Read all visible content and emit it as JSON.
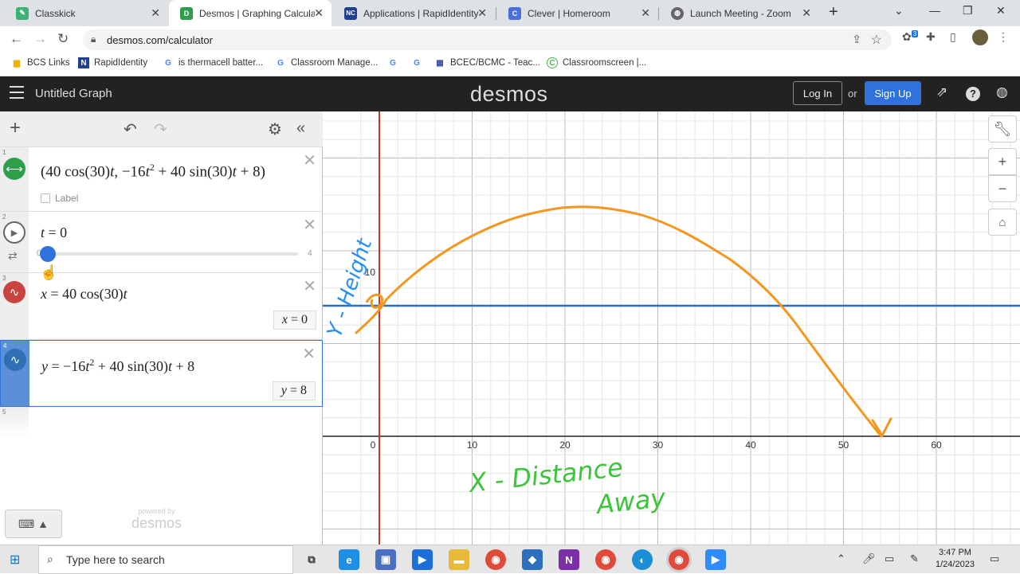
{
  "browser": {
    "tabs": [
      {
        "title": "Classkick",
        "icon": "classkick-icon",
        "color": "#3bb273",
        "glyph": "✎",
        "active": false
      },
      {
        "title": "Desmos | Graphing Calculato",
        "icon": "desmos-icon",
        "color": "#2e9e4a",
        "glyph": "D",
        "active": true
      },
      {
        "title": "Applications | RapidIdentity",
        "icon": "nc-icon",
        "color": "#1f3f8f",
        "glyph": "NC",
        "active": false
      },
      {
        "title": "Clever | Homeroom",
        "icon": "clever-icon",
        "color": "#4a6ee0",
        "glyph": "C",
        "active": false
      },
      {
        "title": "Launch Meeting - Zoom",
        "icon": "globe-icon",
        "color": "#666666",
        "glyph": "◍",
        "active": false
      }
    ],
    "url": "desmos.com/calculator",
    "extension_badge": "3",
    "bookmarks": [
      {
        "label": "BCS Links",
        "icon": "folder-icon",
        "color": "#e8b400",
        "glyph": "▆"
      },
      {
        "label": "RapidIdentity",
        "icon": "nc-icon",
        "color": "#1f3f8f",
        "glyph": "N"
      },
      {
        "label": "is thermacell batter...",
        "icon": "google-icon",
        "color": "#4285f4",
        "glyph": "G"
      },
      {
        "label": "Classroom Manage...",
        "icon": "google-icon",
        "color": "#4285f4",
        "glyph": "G"
      },
      {
        "label": "",
        "icon": "google-icon",
        "color": "#4285f4",
        "glyph": "G"
      },
      {
        "label": "",
        "icon": "google-icon",
        "color": "#4285f4",
        "glyph": "G"
      },
      {
        "label": "BCEC/BCMC - Teac...",
        "icon": "calendar-icon",
        "color": "#3b4ba8",
        "glyph": "▦"
      },
      {
        "label": "Classroomscreen |...",
        "icon": "classroomscreen-icon",
        "color": "#4cb050",
        "glyph": "C"
      }
    ]
  },
  "desmos": {
    "graph_title": "Untitled Graph",
    "logo": "desmos",
    "login": "Log In",
    "or": "or",
    "signup": "Sign Up",
    "expressions": {
      "e1": {
        "num": "1",
        "label_checkbox": "Label"
      },
      "e2": {
        "num": "2",
        "slider_min": "0",
        "slider_max": "4",
        "value": 0
      },
      "e3": {
        "num": "3",
        "eval_var": "x",
        "eval_eq": " = ",
        "eval_val": "0"
      },
      "e4": {
        "num": "4",
        "eval_var": "y",
        "eval_eq": " = ",
        "eval_val": "8"
      },
      "e5": {
        "num": "5"
      }
    },
    "powered_by": "powered by",
    "powered_logo": "desmos"
  },
  "graph": {
    "x_ticks": [
      "0",
      "10",
      "20",
      "30",
      "40",
      "50",
      "60"
    ],
    "y_ticks": [
      "10"
    ],
    "colors": {
      "curve": "#f5961f",
      "hline": "#2d70b3",
      "annotation_blue": "#2a8ff0",
      "annotation_green": "#3cc43a",
      "axis_y_marker": "#c0392b"
    },
    "handwriting": {
      "y_label": "Y - Height",
      "x_label_1": "X - Distance",
      "x_label_2": "Away"
    }
  },
  "taskbar": {
    "search_placeholder": "Type here to search",
    "time": "3:47 PM",
    "date": "1/24/2023"
  }
}
